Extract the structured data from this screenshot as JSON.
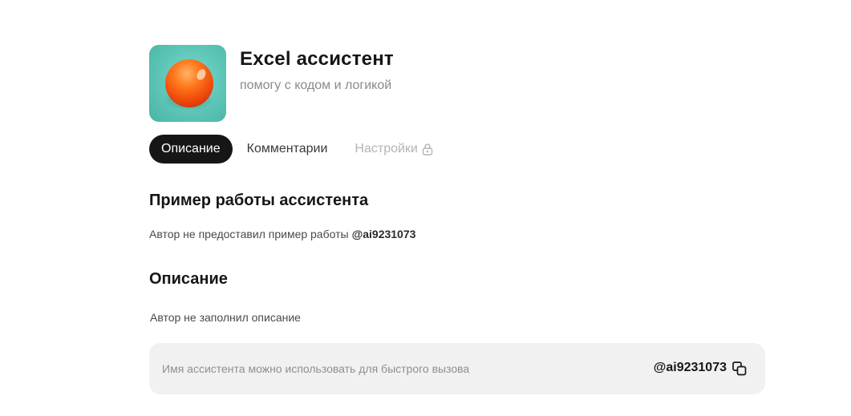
{
  "assistant": {
    "name": "Excel ассистент",
    "tagline": "помогу с кодом и логикой"
  },
  "tabs": [
    {
      "label": "Описание",
      "state": "active"
    },
    {
      "label": "Комментарии",
      "state": "normal"
    },
    {
      "label": "Настройки",
      "state": "locked"
    }
  ],
  "example_section": {
    "heading": "Пример работы ассистента",
    "text": "Автор не предоставил пример работы",
    "handle": "@ai9231073"
  },
  "description_section": {
    "heading": "Описание",
    "text": "Автор не заполнил описание"
  },
  "alias": {
    "hint": "Имя ассистента можно использовать для быстрого вызова",
    "handle": "@ai9231073",
    "copy_icon": "copy-icon"
  },
  "colors": {
    "active_tab_bg": "#161616",
    "alias_box_bg": "#f1f1f1",
    "avatar_bg": "#5cc5b6",
    "avatar_ball": "#ff7a1c"
  }
}
